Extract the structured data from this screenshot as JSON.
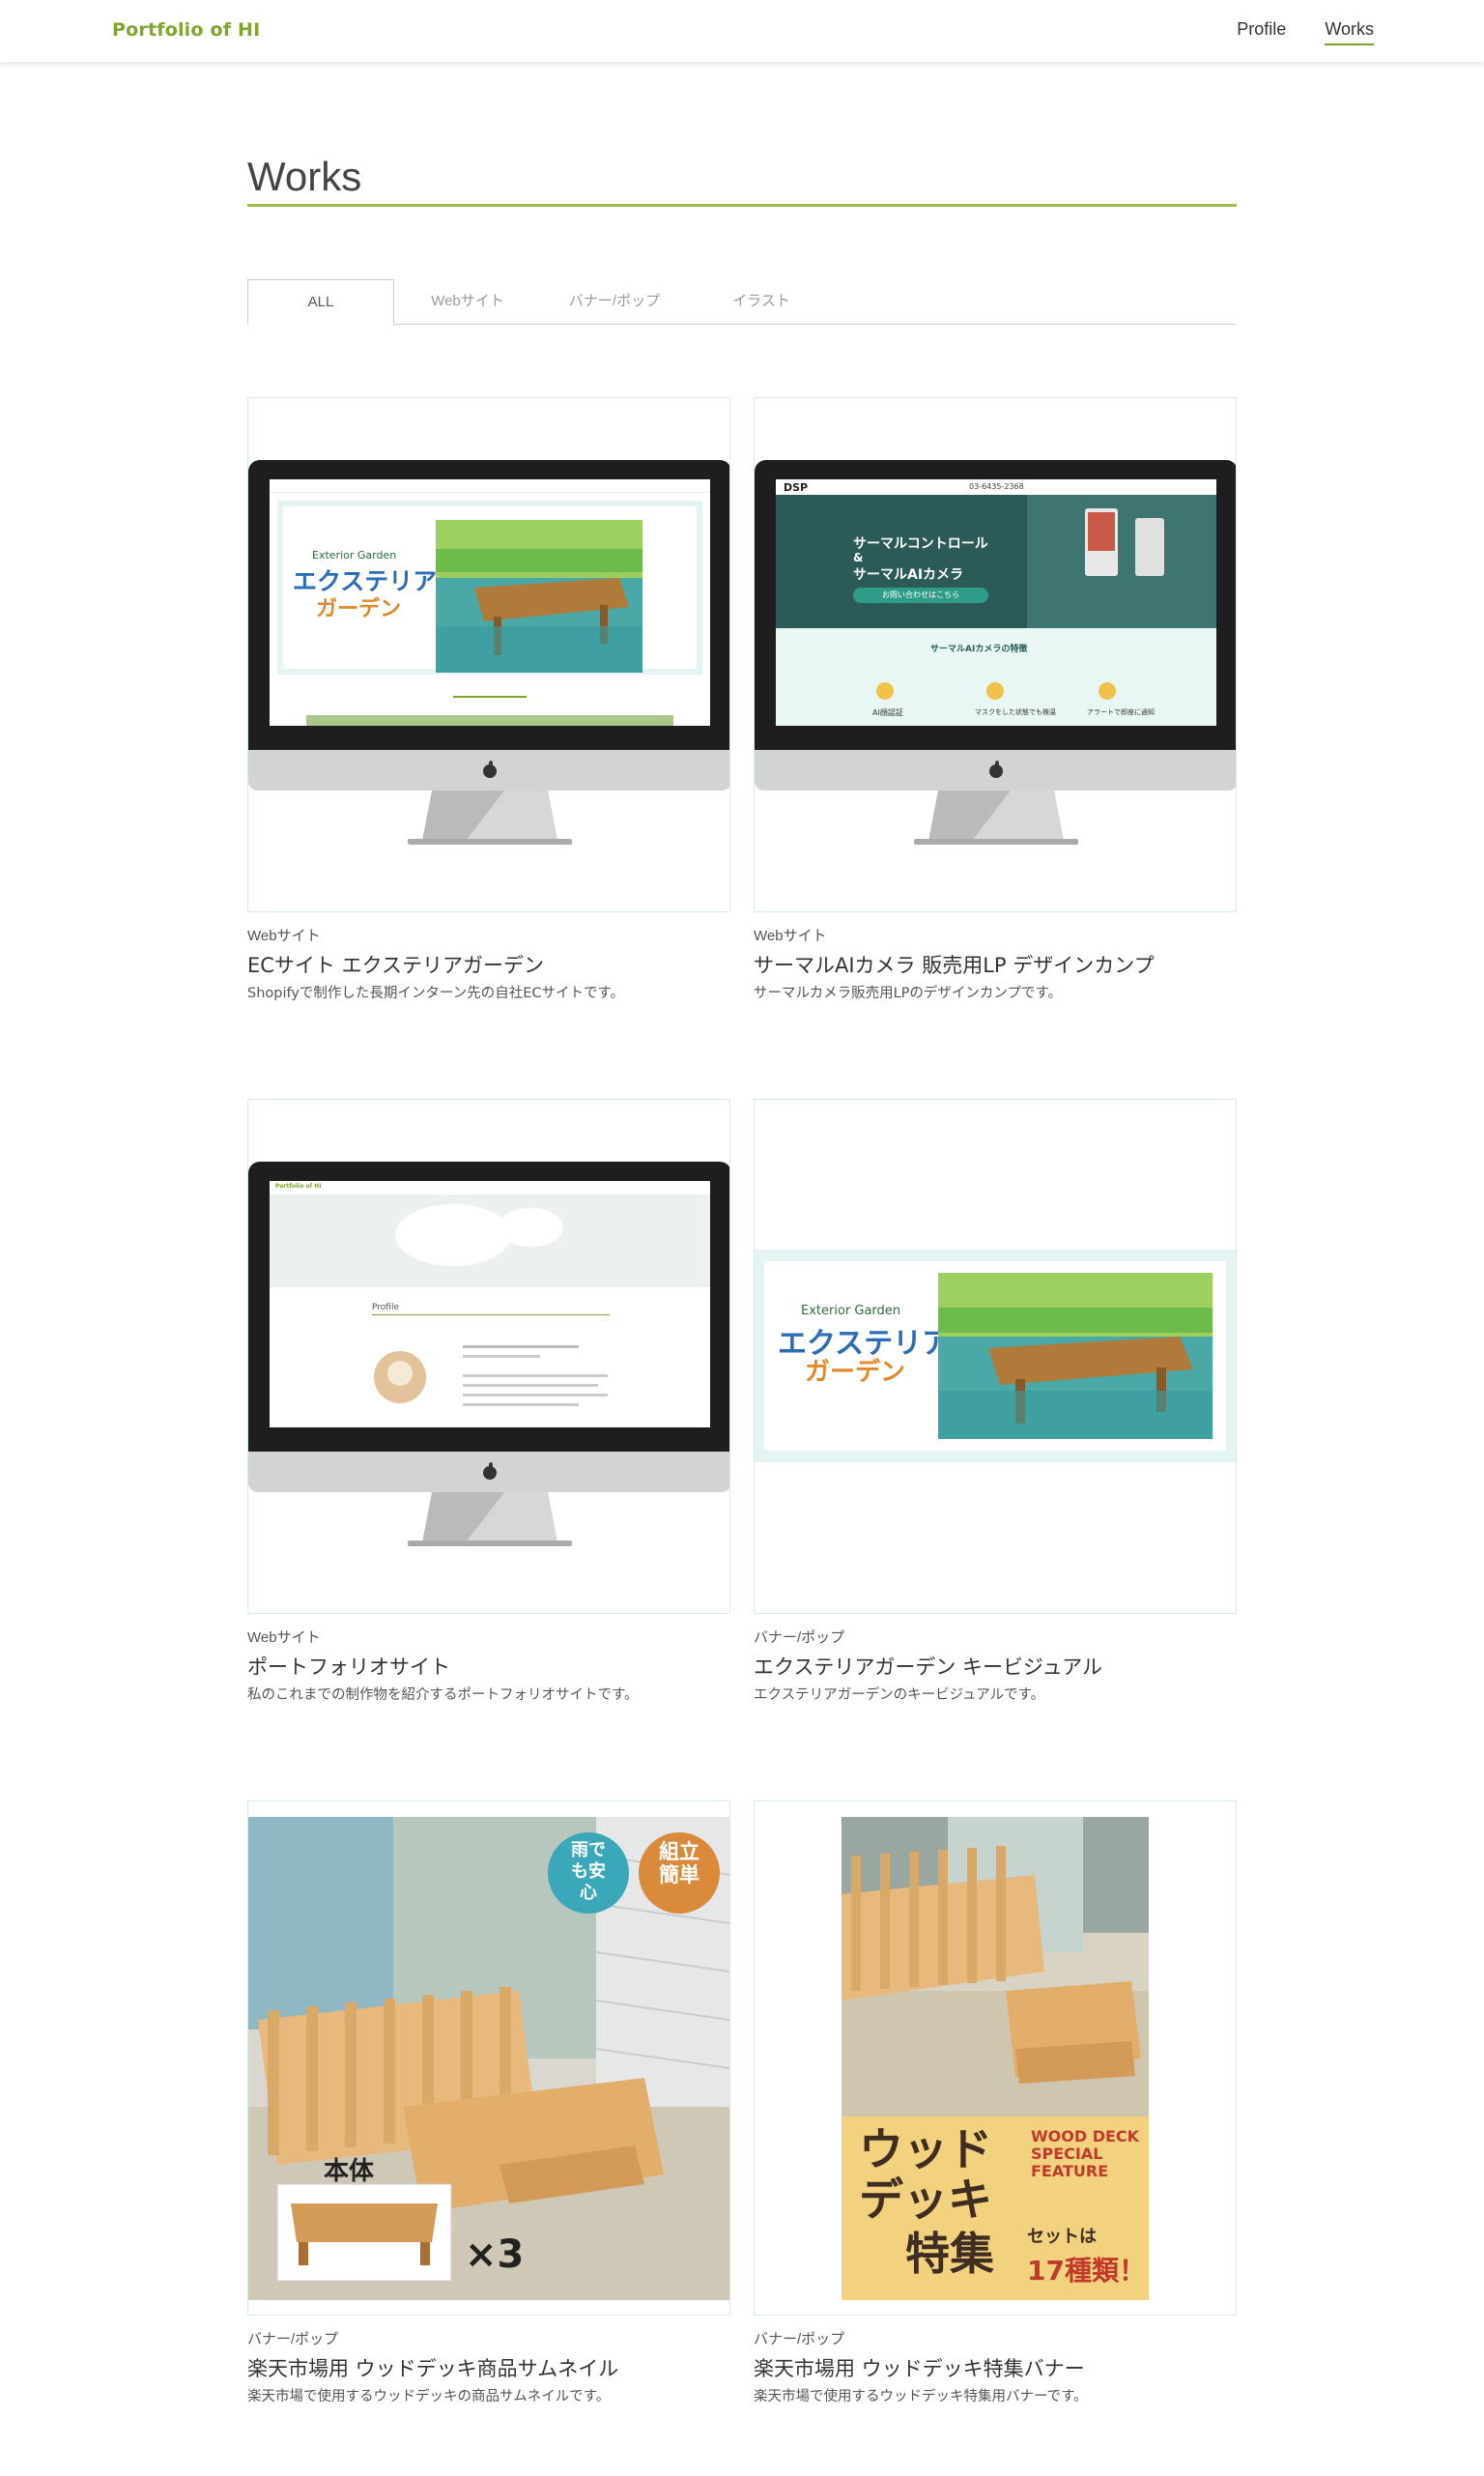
{
  "header": {
    "logo": "Portfolio of HI",
    "nav": [
      {
        "label": "Profile",
        "active": false
      },
      {
        "label": "Works",
        "active": true
      }
    ]
  },
  "page": {
    "title": "Works"
  },
  "tabs": [
    {
      "label": "ALL",
      "active": true
    },
    {
      "label": "Webサイト",
      "active": false
    },
    {
      "label": "バナー/ポップ",
      "active": false
    },
    {
      "label": "イラスト",
      "active": false
    }
  ],
  "works": [
    {
      "category": "Webサイト",
      "title": "ECサイト エクステリアガーデン",
      "description": "Shopifyで制作した長期インターン先の自社ECサイトです。",
      "screen": {
        "brand_small": "Exterior Garden",
        "brand_main_1": "エクステリア",
        "brand_main_2": "ガーデン"
      }
    },
    {
      "category": "Webサイト",
      "title": "サーマルAIカメラ 販売用LP デザインカンプ",
      "description": "サーマルカメラ販売用LPのデザインカンプです。",
      "screen": {
        "logo": "DSP",
        "phone": "03-6435-2368",
        "headline_1": "サーマルコントロール",
        "headline_amp": "&",
        "headline_2": "サーマルAIカメラ",
        "cta": "お問い合わせはこちら",
        "section": "サーマルAIカメラの特徴",
        "features": [
          "AI顔認証",
          "マスクをした状態でも検温",
          "アラートで即座に通知"
        ]
      }
    },
    {
      "category": "Webサイト",
      "title": "ポートフォリオサイト",
      "description": "私のこれまでの制作物を紹介するポートフォリオサイトです。",
      "screen": {
        "logo": "Portfolio of HI",
        "section": "Profile"
      }
    },
    {
      "category": "バナー/ポップ",
      "title": "エクステリアガーデン キービジュアル",
      "description": "エクステリアガーデンのキービジュアルです。",
      "visual": {
        "brand_small": "Exterior Garden",
        "brand_main_1": "エクステリア",
        "brand_main_2": "ガーデン"
      }
    },
    {
      "category": "バナー/ポップ",
      "title": "楽天市場用 ウッドデッキ商品サムネイル",
      "description": "楽天市場で使用するウッドデッキの商品サムネイルです。",
      "visual": {
        "badge_1": "雨でも安心",
        "badge_2": "組立簡単",
        "label_body": "本体",
        "label_count": "×3"
      }
    },
    {
      "category": "バナー/ポップ",
      "title": "楽天市場用 ウッドデッキ特集バナー",
      "description": "楽天市場で使用するウッドデッキ特集用バナーです。",
      "visual": {
        "main_1": "ウッド",
        "main_2": "デッキ",
        "main_3": "特集",
        "en_1": "WOOD DECK",
        "en_2": "SPECIAL",
        "en_3": "FEATURE",
        "set_label": "セットは",
        "set_count": "17種類！"
      }
    }
  ],
  "colors": {
    "accent": "#7fa52a",
    "card_border": "#d6ebe6",
    "mint": "#e4f4f2",
    "wood": "#d9a968",
    "teal": "#3aa8b8"
  }
}
